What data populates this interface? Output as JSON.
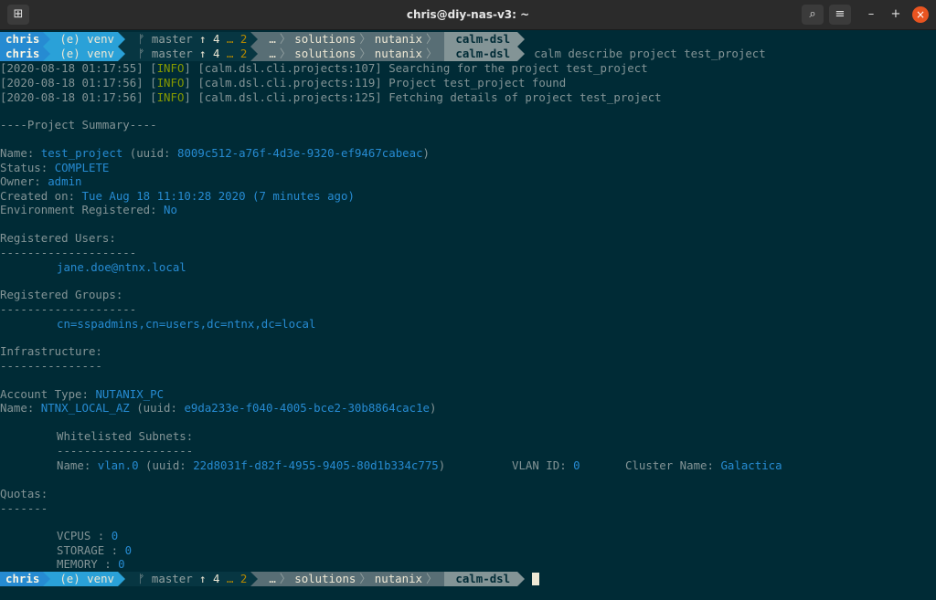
{
  "window": {
    "title": "chris@diy-nas-v3: ~",
    "new_tab_icon": "new-tab-icon",
    "search_icon": "search-icon",
    "menu_icon": "hamburger-menu-icon",
    "minimize": "–",
    "maximize": "+",
    "close": "×"
  },
  "prompt": {
    "user": "chris",
    "venv": "(e) venv",
    "branch_icon": "ᚠ",
    "branch": "master",
    "ahead": "↑ 4",
    "stash": "… 2",
    "ellipsis": "…",
    "dir1": "solutions",
    "dir2": "nutanix",
    "dir3": "calm-dsl",
    "command": "calm describe project test_project"
  },
  "log": [
    {
      "ts": "[2020-08-18 01:17:55]",
      "level": "INFO",
      "msg": "[calm.dsl.cli.projects:107] Searching for the project test_project"
    },
    {
      "ts": "[2020-08-18 01:17:56]",
      "level": "INFO",
      "msg": "[calm.dsl.cli.projects:119] Project test_project found"
    },
    {
      "ts": "[2020-08-18 01:17:56]",
      "level": "INFO",
      "msg": "[calm.dsl.cli.projects:125] Fetching details of project test_project"
    }
  ],
  "summary": {
    "header": "----Project Summary----",
    "name_label": "Name: ",
    "name": "test_project",
    "uuid_label": " (uuid: ",
    "uuid": "8009c512-a76f-4d3e-9320-ef9467cabeac",
    "close_paren": ")",
    "status_label": "Status: ",
    "status": "COMPLETE",
    "owner_label": "Owner: ",
    "owner": "admin",
    "created_label": "Created on: ",
    "created": "Tue Aug 18 11:10:28 2020",
    "created_ago": " (7 minutes ago)",
    "env_label": "Environment Registered: ",
    "env": "No",
    "users_label": "Registered Users:",
    "users_rule": "--------------------",
    "user1": "jane.doe@ntnx.local",
    "groups_label": "Registered Groups:",
    "groups_rule": "--------------------",
    "group1": "cn=sspadmins,cn=users,dc=ntnx,dc=local",
    "infra_label": "Infrastructure:",
    "infra_rule": "---------------",
    "account_label": "Account Type: ",
    "account": "NUTANIX_PC",
    "infra_name_label": "Name: ",
    "infra_name": "NTNX_LOCAL_AZ",
    "infra_uuid_label": " (uuid: ",
    "infra_uuid": "e9da233e-f040-4005-bce2-30b8864cac1e",
    "subnets_label": "Whitelisted Subnets:",
    "subnets_rule": "--------------------",
    "subnet_name_label": "Name: ",
    "subnet_name": "vlan.0",
    "subnet_uuid_label": " (uuid: ",
    "subnet_uuid": "22d8031f-d82f-4955-9405-80d1b334c775",
    "subnet_uuid_close": ")",
    "vlan_label": "VLAN ID: ",
    "vlan": "0",
    "cluster_label": "Cluster Name: ",
    "cluster": "Galactica",
    "quotas_label": "Quotas:",
    "quotas_rule": "-------",
    "vcpus_label": "VCPUS : ",
    "vcpus": "0",
    "storage_label": "STORAGE : ",
    "storage": "0",
    "memory_label": "MEMORY : ",
    "memory": "0"
  }
}
